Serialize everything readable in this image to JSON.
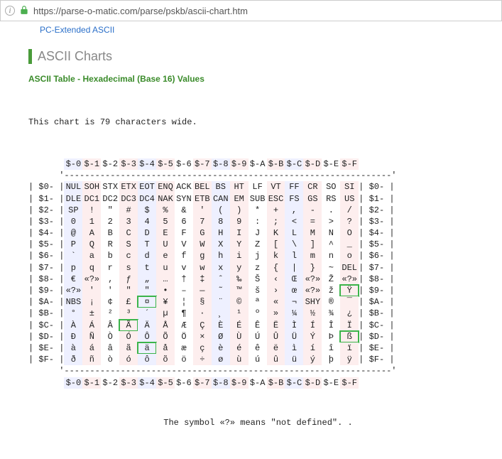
{
  "browser": {
    "url": "https://parse-o-matic.com/parse/pskb/ascii-chart.htm"
  },
  "nav": {
    "prev_link": "PC-Extended ASCII"
  },
  "page": {
    "section": "ASCII Charts",
    "subtitle": "ASCII Table - Hexadecimal (Base 16) Values",
    "width_note": "This chart is 79 characters wide.",
    "footer_note": "The symbol «?» means \"not defined\". ."
  },
  "chart_data": {
    "type": "table",
    "title": "ASCII Table - Hexadecimal (Base 16) Values",
    "columns": [
      "$-0",
      "$-1",
      "$-2",
      "$-3",
      "$-4",
      "$-5",
      "$-6",
      "$-7",
      "$-8",
      "$-9",
      "$-A",
      "$-B",
      "$-C",
      "$-D",
      "$-E",
      "$-F"
    ],
    "row_labels": [
      "$0-",
      "$1-",
      "$2-",
      "$3-",
      "$4-",
      "$5-",
      "$6-",
      "$7-",
      "$8-",
      "$9-",
      "$A-",
      "$B-",
      "$C-",
      "$D-",
      "$E-",
      "$F-"
    ],
    "rows": [
      [
        "NUL",
        "SOH",
        "STX",
        "ETX",
        "EOT",
        "ENQ",
        "ACK",
        "BEL",
        "BS",
        "HT",
        "LF",
        "VT",
        "FF",
        "CR",
        "SO",
        "SI"
      ],
      [
        "DLE",
        "DC1",
        "DC2",
        "DC3",
        "DC4",
        "NAK",
        "SYN",
        "ETB",
        "CAN",
        "EM",
        "SUB",
        "ESC",
        "FS",
        "GS",
        "RS",
        "US"
      ],
      [
        "SP",
        "!",
        "\"",
        "#",
        "$",
        "%",
        "&",
        "'",
        "(",
        ")",
        "*",
        "+",
        ",",
        "-",
        ".",
        "/"
      ],
      [
        "0",
        "1",
        "2",
        "3",
        "4",
        "5",
        "6",
        "7",
        "8",
        "9",
        ":",
        ";",
        "<",
        "=",
        ">",
        "?"
      ],
      [
        "@",
        "A",
        "B",
        "C",
        "D",
        "E",
        "F",
        "G",
        "H",
        "I",
        "J",
        "K",
        "L",
        "M",
        "N",
        "O"
      ],
      [
        "P",
        "Q",
        "R",
        "S",
        "T",
        "U",
        "V",
        "W",
        "X",
        "Y",
        "Z",
        "[",
        "\\",
        "]",
        "^",
        "_"
      ],
      [
        "`",
        "a",
        "b",
        "c",
        "d",
        "e",
        "f",
        "g",
        "h",
        "i",
        "j",
        "k",
        "l",
        "m",
        "n",
        "o"
      ],
      [
        "p",
        "q",
        "r",
        "s",
        "t",
        "u",
        "v",
        "w",
        "x",
        "y",
        "z",
        "{",
        "|",
        "}",
        "~",
        "DEL"
      ],
      [
        "€",
        "«?»",
        "‚",
        "ƒ",
        "„",
        "…",
        "†",
        "‡",
        "ˆ",
        "‰",
        "Š",
        "‹",
        "Œ",
        "«?»",
        "Ž",
        "«?»"
      ],
      [
        "«?»",
        "'",
        "'",
        "\"",
        "\"",
        "•",
        "–",
        "—",
        "˜",
        "™",
        "š",
        "›",
        "œ",
        "«?»",
        "ž",
        "Ÿ"
      ],
      [
        "NBS",
        "¡",
        "¢",
        "£",
        "¤",
        "¥",
        "¦",
        "§",
        "¨",
        "©",
        "ª",
        "«",
        "¬",
        "SHY",
        "®",
        "¯"
      ],
      [
        "°",
        "±",
        "²",
        "³",
        "´",
        "µ",
        "¶",
        "·",
        "¸",
        "¹",
        "º",
        "»",
        "¼",
        "½",
        "¾",
        "¿"
      ],
      [
        "À",
        "Á",
        "Â",
        "Ã",
        "Ä",
        "Å",
        "Æ",
        "Ç",
        "È",
        "É",
        "Ê",
        "Ë",
        "Ì",
        "Í",
        "Î",
        "Ï"
      ],
      [
        "Ð",
        "Ñ",
        "Ò",
        "Ó",
        "Ô",
        "Õ",
        "Ö",
        "×",
        "Ø",
        "Ù",
        "Ú",
        "Û",
        "Ü",
        "Ý",
        "Þ",
        "ß"
      ],
      [
        "à",
        "á",
        "â",
        "ã",
        "ä",
        "å",
        "æ",
        "ç",
        "è",
        "é",
        "ê",
        "ë",
        "ì",
        "í",
        "î",
        "ï"
      ],
      [
        "ð",
        "ñ",
        "ò",
        "ó",
        "ô",
        "õ",
        "ö",
        "÷",
        "ø",
        "ù",
        "ú",
        "û",
        "ü",
        "ý",
        "þ",
        "ÿ"
      ]
    ],
    "highlighted": [
      "9,F",
      "A,4",
      "C,3",
      "D,F",
      "E,4"
    ]
  }
}
